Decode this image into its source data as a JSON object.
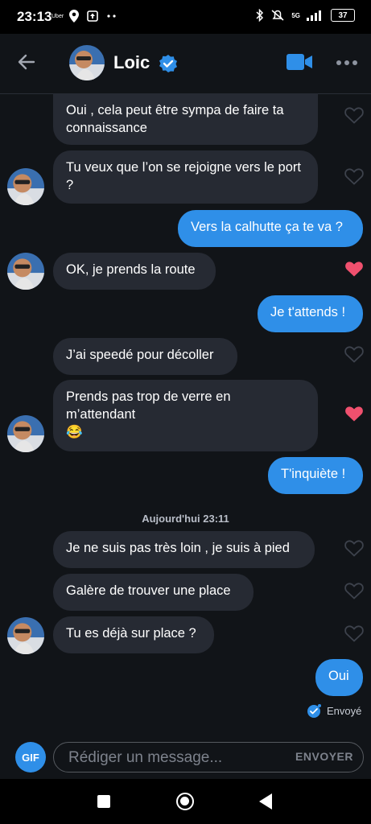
{
  "status_bar": {
    "time": "23:13",
    "uber": "Uber",
    "network": "5G",
    "battery": "37"
  },
  "header": {
    "contact_name": "Loic"
  },
  "messages": [
    {
      "text": "Oui , cela peut être sympa de faire ta connaissance",
      "liked": false
    },
    {
      "text": "Tu veux que l’on se rejoigne vers le port ?",
      "liked": false
    },
    {
      "text": "Vers la calhutte ça te va ?"
    },
    {
      "text": "OK, je prends la route",
      "liked": true
    },
    {
      "text": "Je t'attends !"
    },
    {
      "text": "J’ai speedé pour décoller",
      "liked": false
    },
    {
      "text": "Prends pas trop de verre en m’attendant",
      "emoji": "😂",
      "liked": true
    },
    {
      "text": "T'inquiète !"
    },
    {
      "text": "Je ne suis pas très loin , je suis à pied",
      "liked": false
    },
    {
      "text": "Galère de trouver une place",
      "liked": false
    },
    {
      "text": "Tu es déjà sur place ?",
      "liked": false
    },
    {
      "text": "Oui"
    }
  ],
  "day_separator": "Aujourd'hui 23:11",
  "sent_status": "Envoyé",
  "composer": {
    "gif_label": "GIF",
    "placeholder": "Rédiger un message...",
    "send_label": "ENVOYER"
  },
  "colors": {
    "accent": "#2f8fe8",
    "incoming_bubble": "#262a33",
    "background": "#111418",
    "heart_liked": "#f0506e"
  },
  "icons": [
    "back-arrow-icon",
    "verified-icon",
    "video-call-icon",
    "more-icon",
    "heart-icon",
    "sent-check-icon"
  ]
}
